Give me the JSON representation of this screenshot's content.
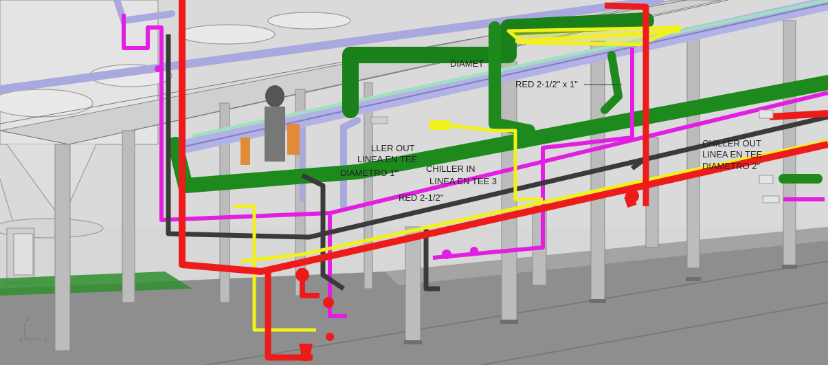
{
  "viewport": {
    "annotations": [
      {
        "id": "diameter-label",
        "text": "DIAMET"
      },
      {
        "id": "reducer-label",
        "text": "RED 2-1/2\" x 1\""
      },
      {
        "id": "chiller-out-label",
        "text": "CHILLER OUT"
      },
      {
        "id": "linea-en-tee-label",
        "text": "LINEA EN TEE"
      },
      {
        "id": "diametro-right-label",
        "text": "DIAMETRO 2\""
      },
      {
        "id": "chiller-out-left-label",
        "text": "LLER OUT"
      },
      {
        "id": "linea-tee-left-label",
        "text": "LINEA EN TEE"
      },
      {
        "id": "diametro-left-label",
        "text": "DIAMETRO 1\""
      },
      {
        "id": "chiller-in-label",
        "text": "CHILLER IN"
      },
      {
        "id": "linea-en-tee3-label",
        "text": "LINEA EN TEE 3"
      },
      {
        "id": "red-label",
        "text": "RED 2-1/2\""
      }
    ],
    "axis": {
      "x": "x",
      "y": "y",
      "z": "z"
    }
  },
  "colors": {
    "background": "#cfcfcf",
    "floor": "#8e8e8e",
    "pipe_red": "#ee1b1b",
    "pipe_magenta": "#e21ee2",
    "pipe_green": "#1e8a1e",
    "pipe_lavender": "#a9a9df",
    "pipe_dark": "#3a3a3a",
    "pipe_yellow": "#f2f21a",
    "pipe_mint": "#9fe0bf",
    "structure": "#b8b8b8"
  }
}
